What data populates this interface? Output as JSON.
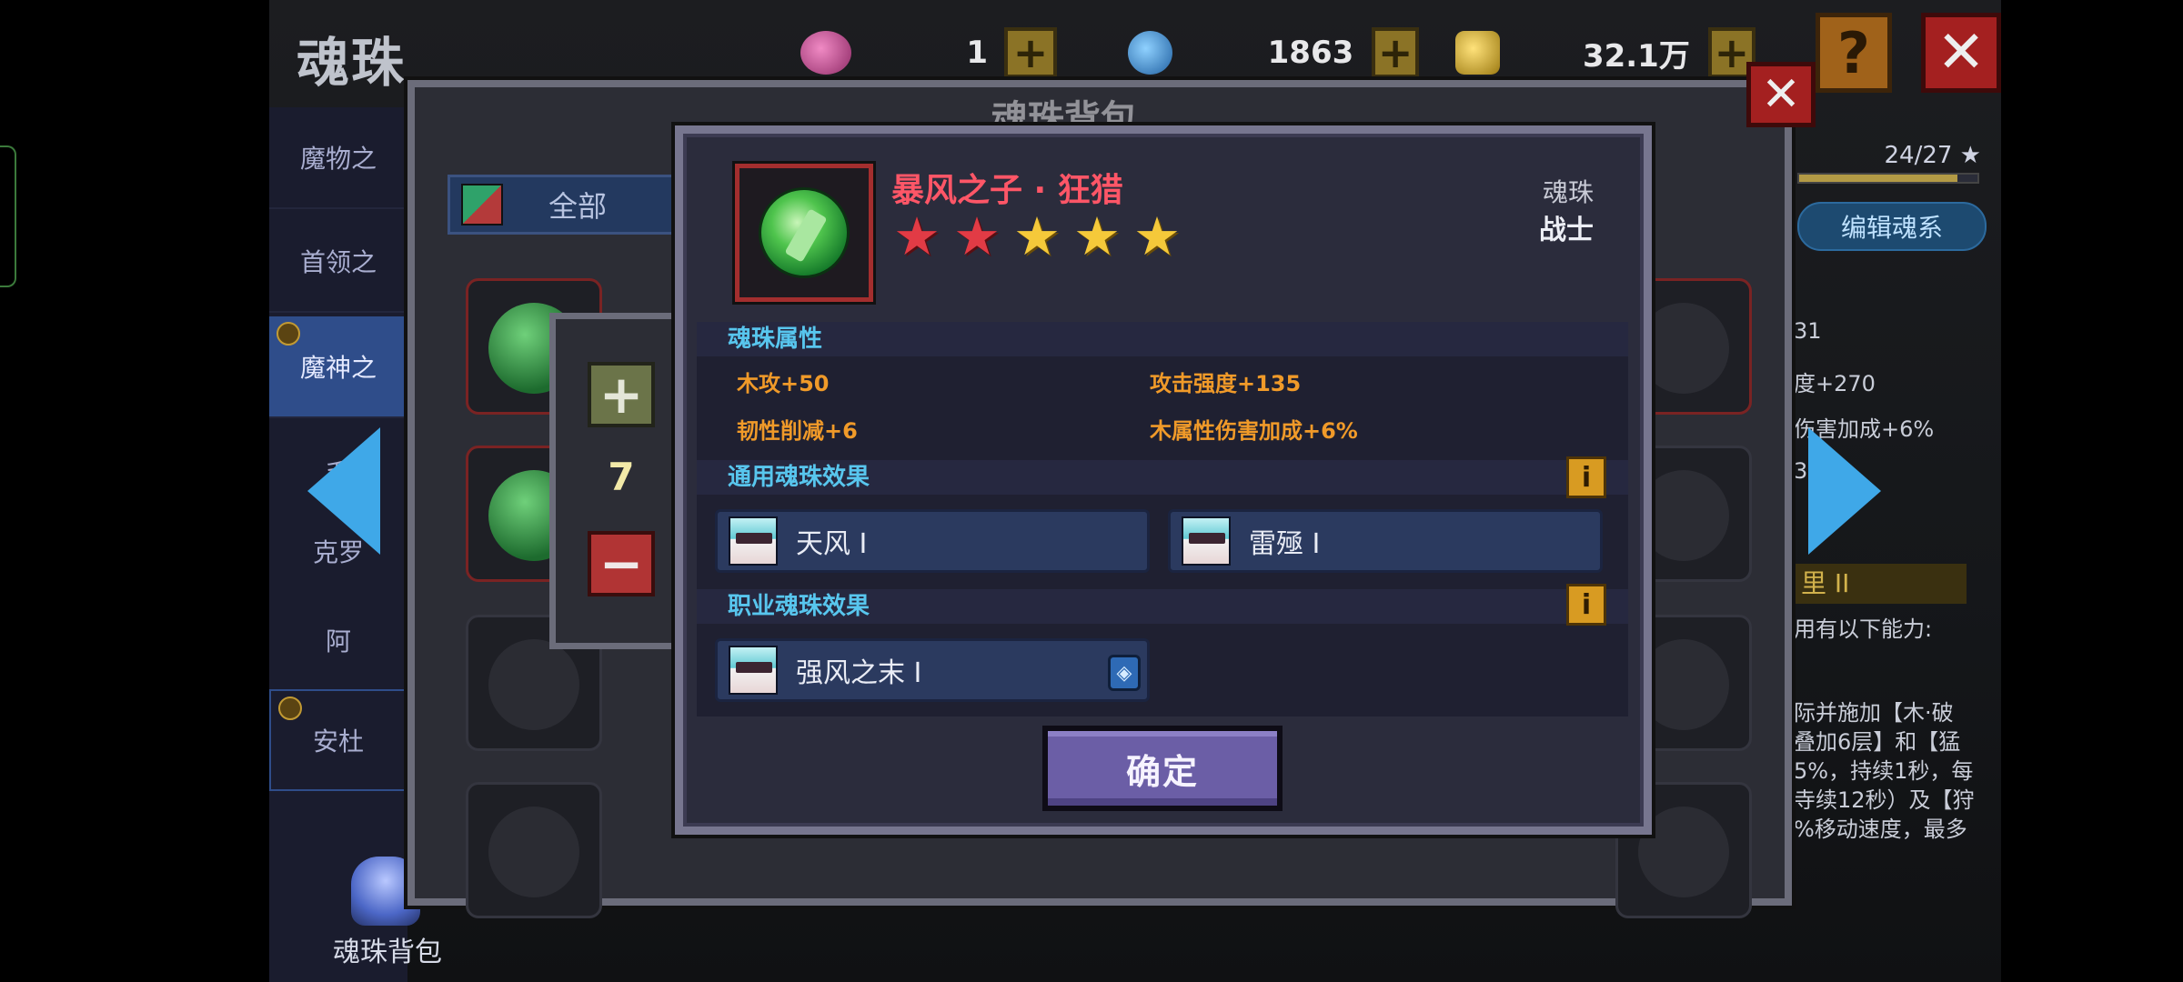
{
  "screen": {
    "title": "魂珠"
  },
  "currencies": [
    {
      "icon": "purple-gem-icon",
      "value": "1",
      "color": "#c54a95"
    },
    {
      "icon": "blue-gem-icon",
      "value": "1863",
      "color": "#3a8fd6"
    },
    {
      "icon": "gold-coin-icon",
      "value": "32.1万",
      "color": "#d6b32a"
    }
  ],
  "top_buttons": {
    "help": "?",
    "close": "✕"
  },
  "sidebar": {
    "items": [
      {
        "label": "魔物之"
      },
      {
        "label": "首领之"
      },
      {
        "label": "魔神之"
      },
      {
        "label": "毛"
      },
      {
        "label": "克罗"
      },
      {
        "label": "阿"
      },
      {
        "label": "安杜"
      }
    ],
    "footer_label": "魂珠背包"
  },
  "right_info": {
    "progress_text": "24/27 ★",
    "progress": 0.889,
    "edit_button": "编辑魂系",
    "lines": [
      "31",
      "度+270",
      "伤害加成+6%",
      "3"
    ],
    "tag": "里 II",
    "ability_text": "用有以下能力:",
    "desc": [
      "际并施加【木·破",
      "叠加6层】和【猛",
      "5%，持续1秒，每",
      "寺续12秒）及【狩",
      "%移动速度，最多"
    ]
  },
  "backpack": {
    "title": "魂珠背包",
    "close": "✕",
    "filter_label": "全部"
  },
  "quantity": {
    "plus": "+",
    "value": "7",
    "minus": "−"
  },
  "detail": {
    "name": "暴风之子 · 狂猎",
    "stars": {
      "total": 5,
      "red": 2,
      "gold": 3
    },
    "type": "魂珠",
    "class": "战士",
    "attr_header": "魂珠属性",
    "attributes": [
      "木攻+50",
      "攻击强度+135",
      "韧性削减+6",
      "木属性伤害加成+6%"
    ],
    "general_header": "通用魂珠效果",
    "general_effects": [
      "天风 Ⅰ",
      "雷殛 Ⅰ"
    ],
    "class_header": "职业魂珠效果",
    "class_effects": [
      "强风之末 Ⅰ"
    ],
    "info_badge": "i",
    "confirm": "确定"
  },
  "colors": {
    "name_red": "#ff5667",
    "section_cyan": "#58c6ee",
    "attr_orange": "#f09a29",
    "confirm_purple": "#6b5ea6"
  }
}
